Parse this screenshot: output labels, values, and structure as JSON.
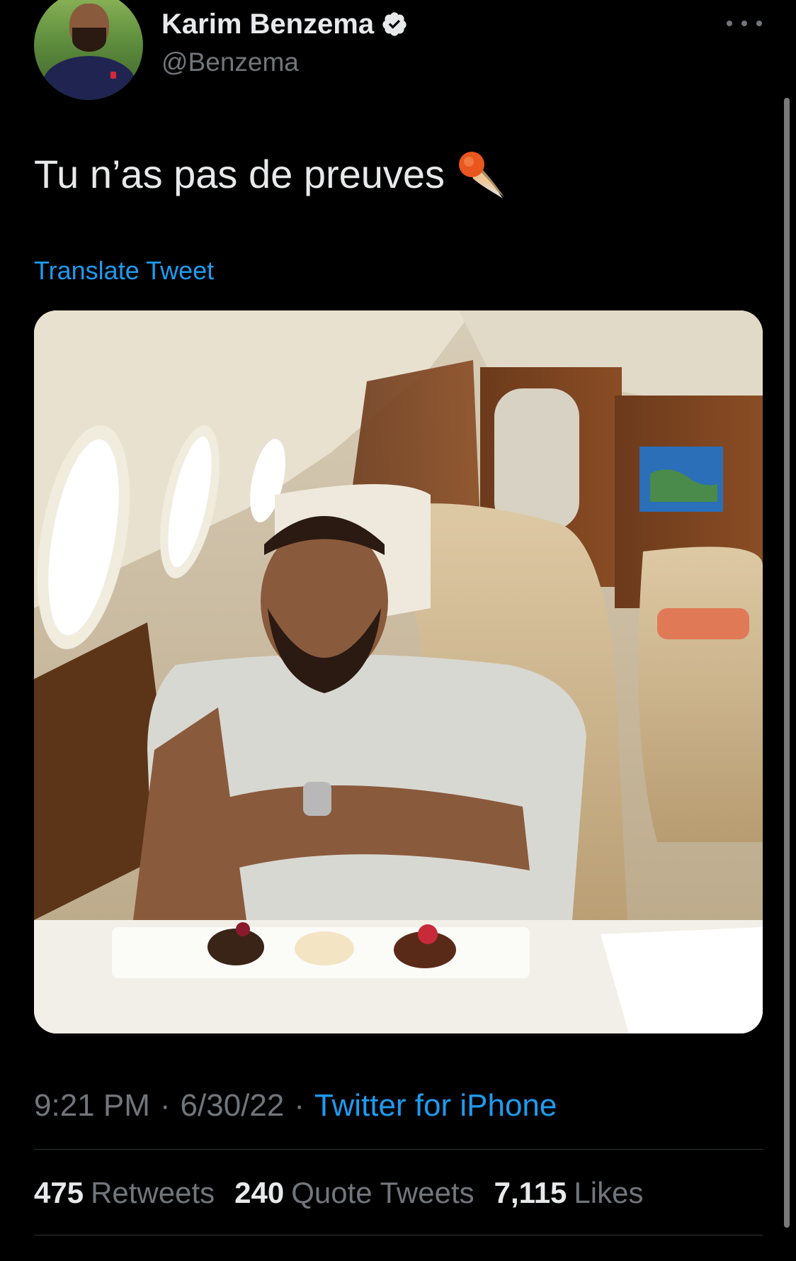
{
  "tweet": {
    "author": {
      "display_name": "Karim Benzema",
      "handle": "@Benzema",
      "verified": true
    },
    "text": "Tu n’as pas de preuves",
    "emoji": "comet-icon",
    "translate_label": "Translate Tweet",
    "media": {
      "alt": "photo"
    },
    "meta": {
      "time": "9:21 PM",
      "separator1": "·",
      "date": "6/30/22",
      "separator2": "·",
      "source": "Twitter for iPhone"
    },
    "stats": [
      {
        "count": "475",
        "label": "Retweets"
      },
      {
        "count": "240",
        "label": "Quote Tweets"
      },
      {
        "count": "7,115",
        "label": "Likes"
      }
    ]
  },
  "colors": {
    "background": "#000000",
    "text": "#e7e9ea",
    "secondary": "#71767b",
    "accent": "#1d9bf0",
    "divider": "#2f3336"
  }
}
